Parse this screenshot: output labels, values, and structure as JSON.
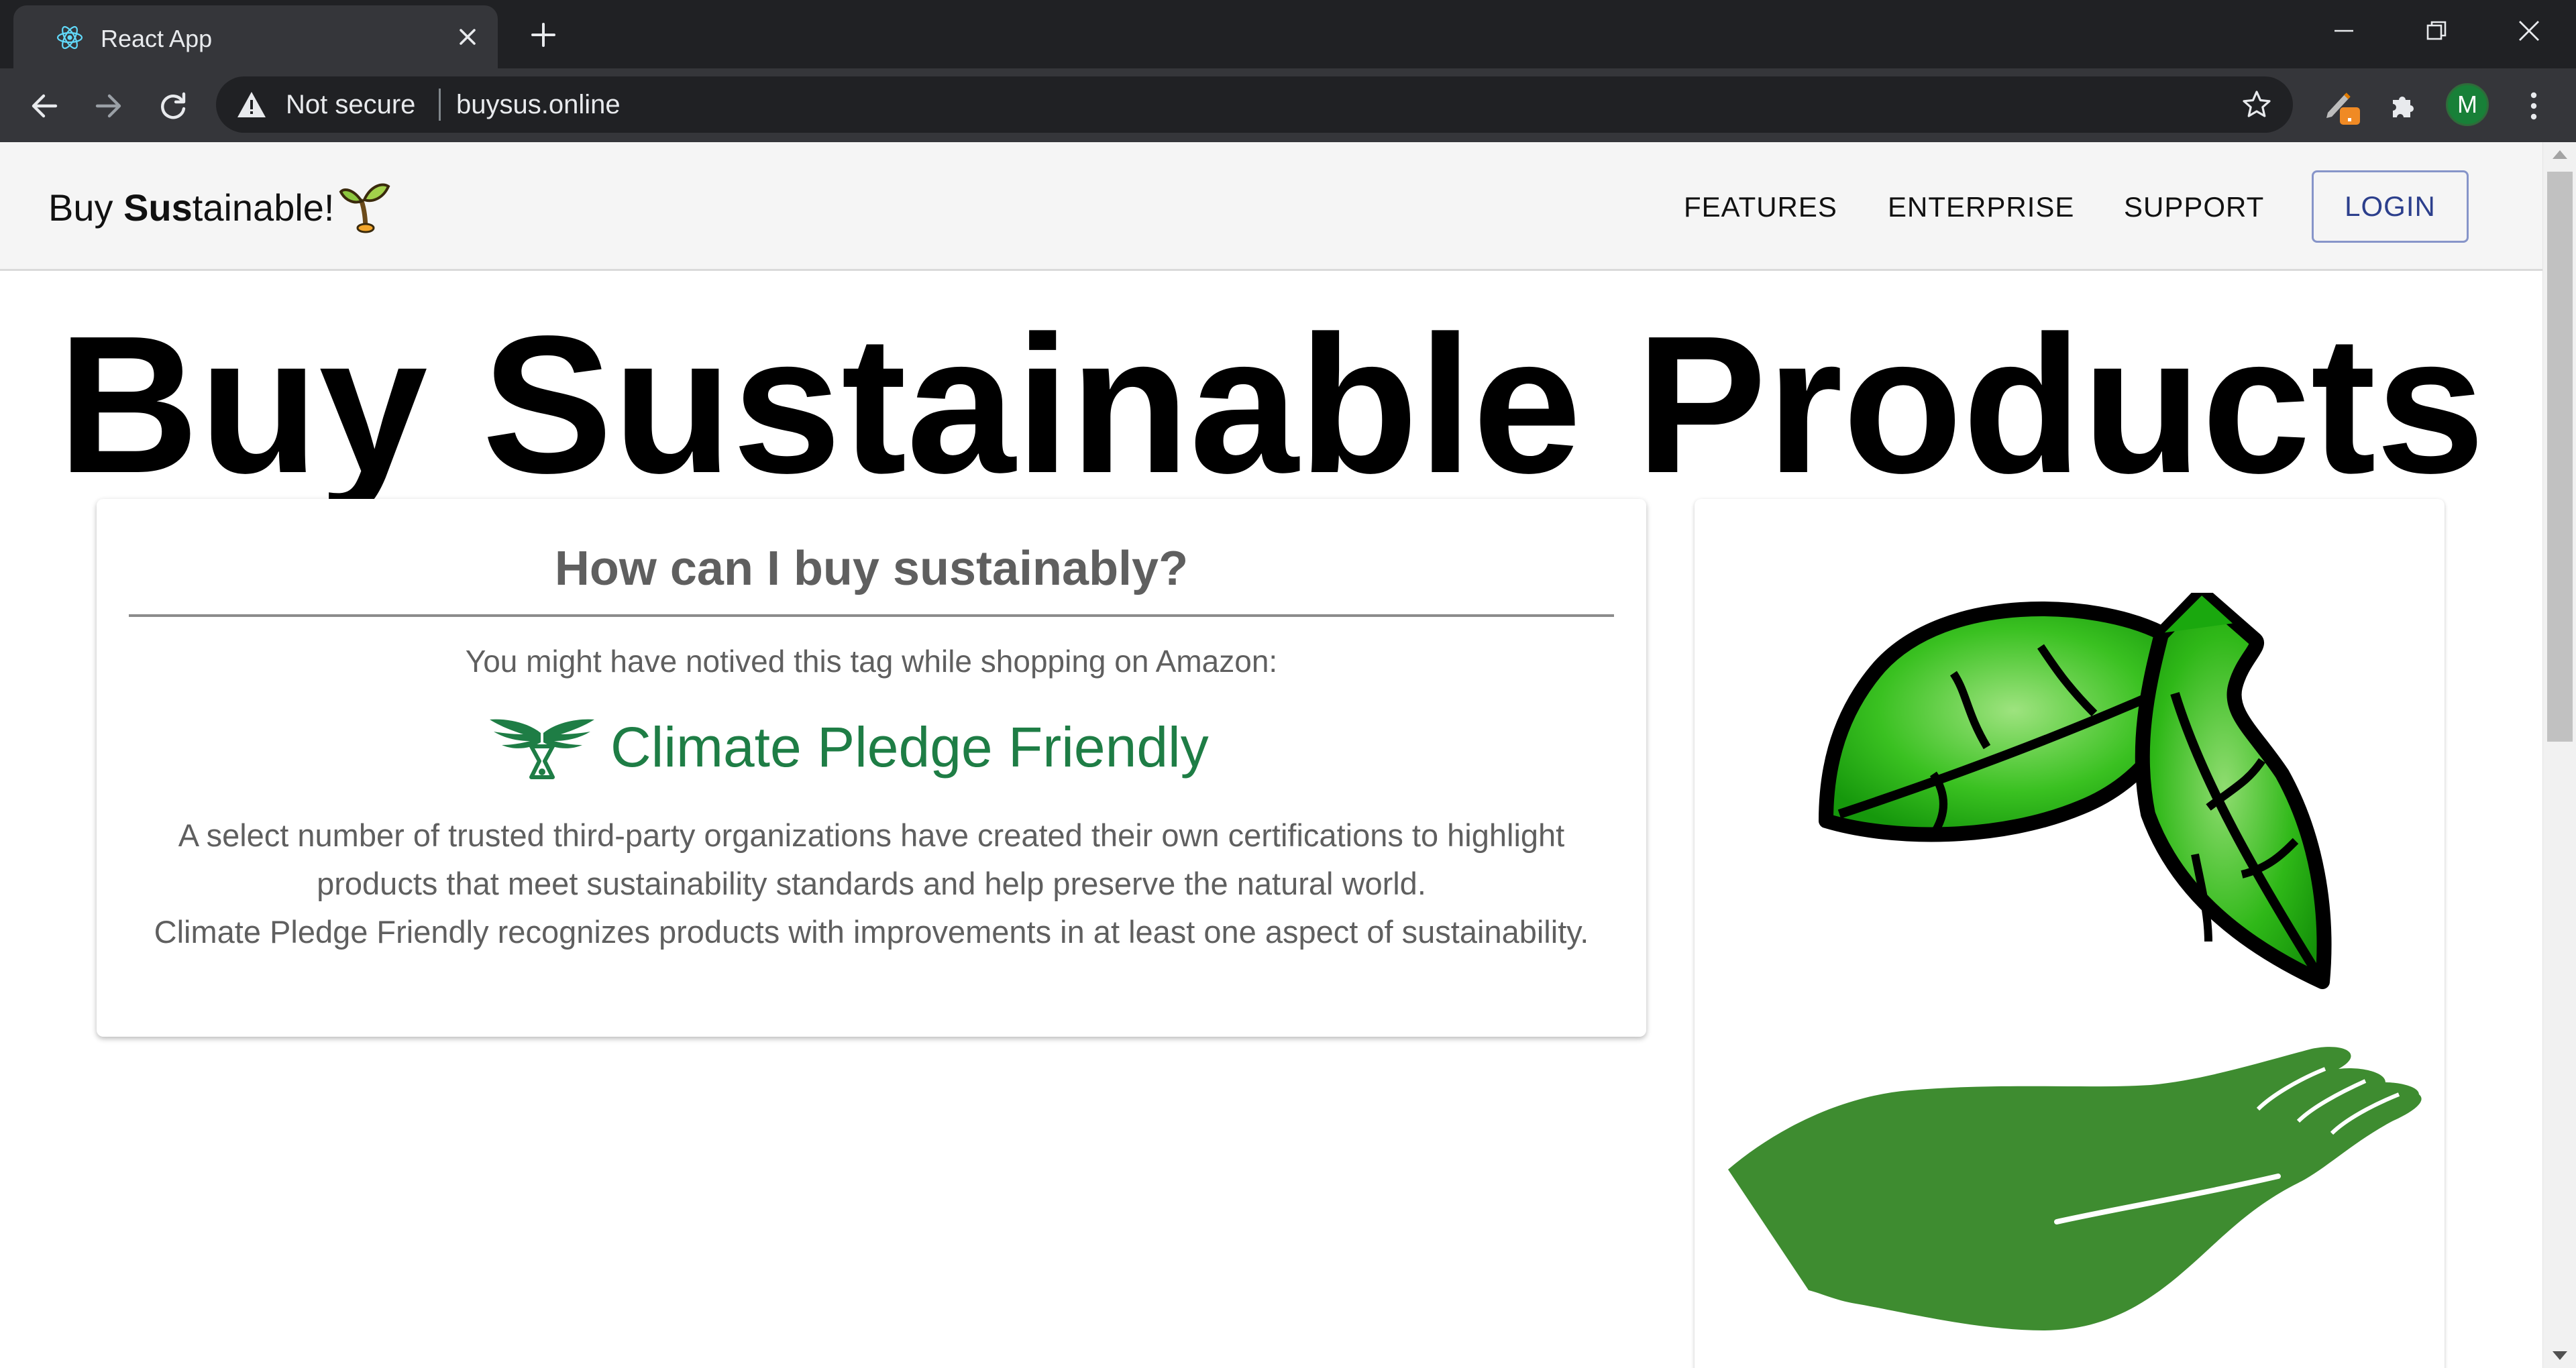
{
  "browser": {
    "tab_title": "React App",
    "security_label": "Not secure",
    "url": "buysus.online",
    "profile_initial": "M"
  },
  "site": {
    "brand_regular_1": "Buy ",
    "brand_bold": "Sus",
    "brand_regular_2": "tainable!",
    "nav": {
      "features": "FEATURES",
      "enterprise": "ENTERPRISE",
      "support": "SUPPORT",
      "login": "LOGIN"
    }
  },
  "hero": {
    "part1": "Buy ",
    "bold": "Sus",
    "part2": "tainable Products"
  },
  "info_card": {
    "title": "How can I buy sustainably?",
    "subtitle": "You might have notived this tag while shopping on Amazon:",
    "badge_text": "Climate Pledge Friendly",
    "paragraph_1": "A select number of trusted third-party organizations have created their own certifications to highlight products that meet sustainability standards and help preserve the natural world.",
    "paragraph_2": "Climate Pledge Friendly recognizes products with improvements in at least one aspect of sustainability."
  },
  "colors": {
    "badge_green": "#1e7d45",
    "leaf_green": "#22b014",
    "hand_green": "#3e8c30",
    "login_border": "#8795c9",
    "profile_green": "#188038"
  },
  "icons": [
    "react-logo-icon",
    "close-icon",
    "plus-icon",
    "minimize-icon",
    "restore-icon",
    "back-arrow-icon",
    "forward-arrow-icon",
    "reload-icon",
    "warning-icon",
    "star-icon",
    "pen-extension-icon",
    "puzzle-extension-icon",
    "kebab-menu-icon",
    "sprout-icon",
    "climate-pledge-emblem-icon",
    "leaves-icon",
    "hand-icon"
  ]
}
